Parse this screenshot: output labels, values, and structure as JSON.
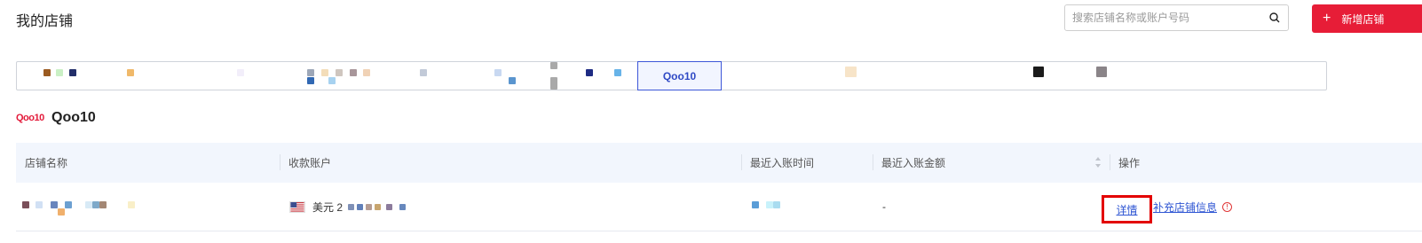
{
  "header": {
    "title": "我的店铺",
    "search_placeholder": "搜索店铺名称或账户号码",
    "search_icon": "search-icon",
    "new_store_label": "新增店铺"
  },
  "tabs": {
    "active_label": "Qoo10"
  },
  "platform": {
    "logo_text": "Qoo10",
    "name": "Qoo10"
  },
  "table": {
    "columns": [
      "店铺名称",
      "收款账户",
      "最近入账时间",
      "最近入账金额",
      "操作"
    ],
    "rows": [
      {
        "account_currency": "美元 2",
        "recent_amount": "-",
        "detail_label": "详情",
        "supplement_label": "补充店铺信息"
      }
    ]
  },
  "colors": {
    "accent": "#e71d37",
    "active_tab": "#3d57d8",
    "link": "#2f56d3"
  }
}
